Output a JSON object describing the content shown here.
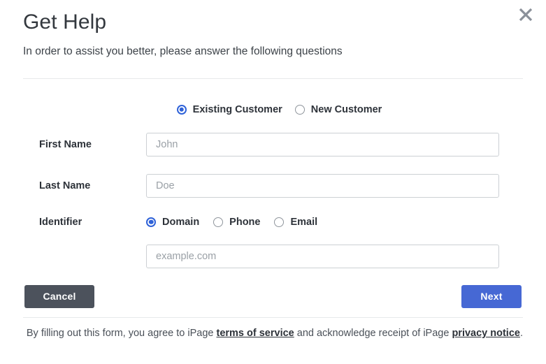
{
  "dialog": {
    "title": "Get Help",
    "subtitle": "In order to assist you better, please answer the following questions",
    "close_icon": "close-icon"
  },
  "customer_type": {
    "options": [
      {
        "label": "Existing Customer",
        "selected": true
      },
      {
        "label": "New Customer",
        "selected": false
      }
    ]
  },
  "fields": {
    "first_name": {
      "label": "First Name",
      "placeholder": "John",
      "value": ""
    },
    "last_name": {
      "label": "Last Name",
      "placeholder": "Doe",
      "value": ""
    },
    "identifier": {
      "label": "Identifier",
      "options": [
        {
          "label": "Domain",
          "selected": true
        },
        {
          "label": "Phone",
          "selected": false
        },
        {
          "label": "Email",
          "selected": false
        }
      ],
      "input": {
        "placeholder": "example.com",
        "value": ""
      }
    }
  },
  "actions": {
    "cancel_label": "Cancel",
    "next_label": "Next"
  },
  "footer": {
    "text_before": "By filling out this form, you agree to iPage ",
    "link_terms": "terms of service",
    "text_middle": " and acknowledge receipt of iPage ",
    "link_privacy": "privacy notice",
    "text_after": "."
  },
  "colors": {
    "accent_blue": "#4668d4",
    "radio_blue": "#2f62d8",
    "cancel_gray": "#4c525c",
    "border_gray": "#ccd0d4",
    "divider": "#e7e9eb"
  }
}
